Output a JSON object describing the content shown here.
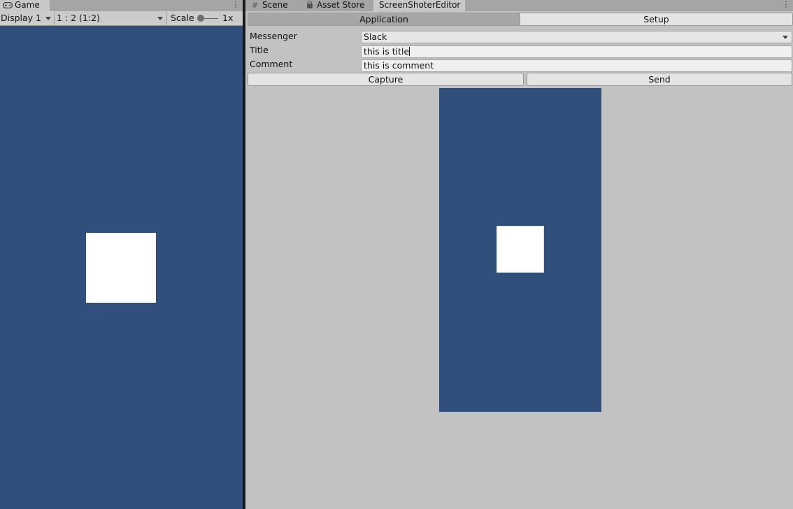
{
  "game_panel": {
    "tab_label": "Game",
    "toolbar": {
      "display": "Display 1",
      "aspect": "1 : 2 (1:2)",
      "scale_label": "Scale",
      "scale_value": "1x"
    },
    "background_color": "#304f7a",
    "square_color": "#ffffff"
  },
  "editor_panel": {
    "tabs": [
      {
        "label": "Scene",
        "icon": "grid-icon"
      },
      {
        "label": "Asset Store",
        "icon": "lock-icon"
      },
      {
        "label": "ScreenShoterEditor",
        "active": true
      }
    ],
    "mode_toggle": {
      "application": "Application",
      "setup": "Setup",
      "selected": "Application"
    },
    "fields": {
      "messenger_label": "Messenger",
      "messenger_value": "Slack",
      "title_label": "Title",
      "title_value": "this is title",
      "comment_label": "Comment",
      "comment_value": "this is comment"
    },
    "buttons": {
      "capture": "Capture",
      "send": "Send"
    },
    "preview": {
      "background_color": "#304f7a",
      "square_color": "#ffffff"
    }
  }
}
